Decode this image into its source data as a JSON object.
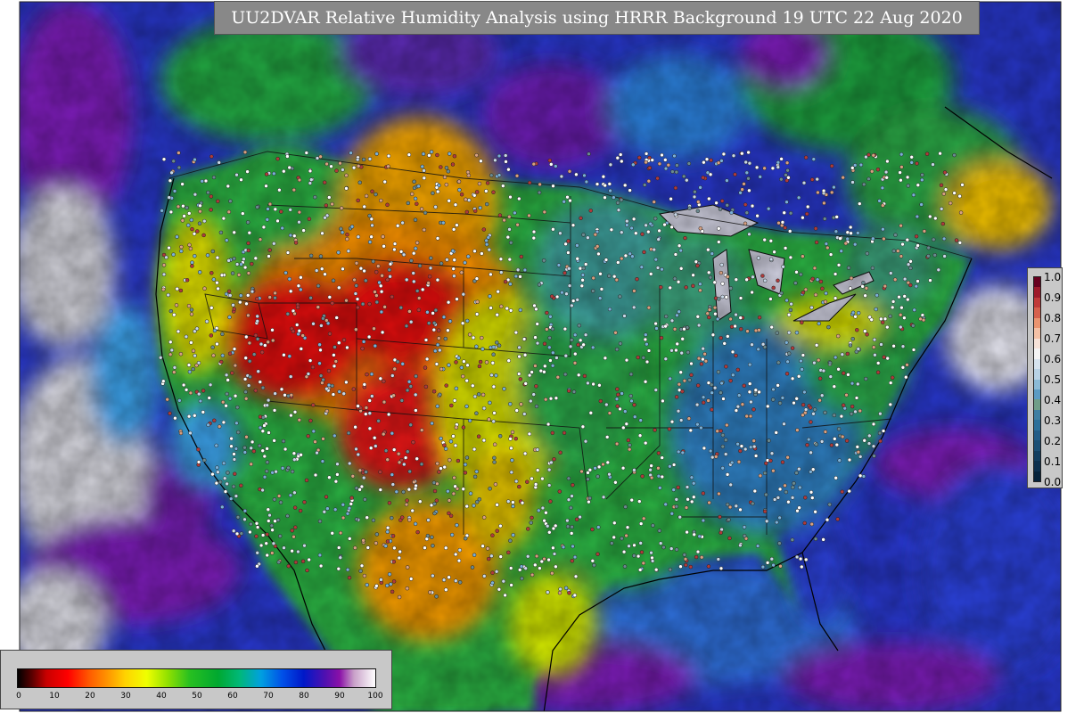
{
  "title": "UU2DVAR Relative Humidity Analysis using HRRR Background 19 UTC 22 Aug 2020",
  "obs_legend": {
    "labels": [
      "1.0",
      "0.9",
      "0.8",
      "0.7",
      "0.6",
      "0.5",
      "0.4",
      "0.3",
      "0.2",
      "0.1",
      "0.0"
    ],
    "colors": [
      "#67001f",
      "#9e1a2b",
      "#c03a3a",
      "#d6604d",
      "#ea9470",
      "#f4c1a6",
      "#f6e2d8",
      "#f4f4f4",
      "#d6e3ee",
      "#b8d2e5",
      "#8bbad6",
      "#5c9bc3",
      "#6f9e88",
      "#3f7fa3",
      "#2c6f9a",
      "#235c87",
      "#1b4f75",
      "#123e60",
      "#0b2f4d",
      "#05223a"
    ]
  },
  "rh_legend": {
    "ticks": [
      "0",
      "10",
      "20",
      "30",
      "40",
      "50",
      "60",
      "70",
      "80",
      "90",
      "100"
    ]
  },
  "map": {
    "field": "relative-humidity",
    "palette": {
      "ocean_wet": "#2d38d0",
      "very_wet": "#6a1bb0",
      "saturated": "#d8d8d8",
      "moist": "#1f74d8",
      "mid": "#19a93b",
      "dry_mid": "#c8e000",
      "dry": "#f09b00",
      "very_dry": "#dd0c0c",
      "land_green": "#2fb84a",
      "teal": "#3d9e9c"
    }
  }
}
